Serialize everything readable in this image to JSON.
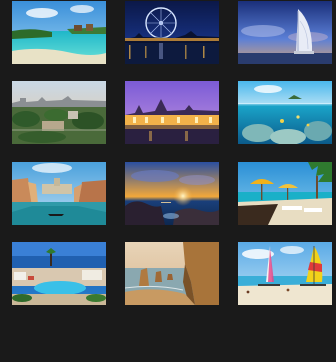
{
  "gallery": {
    "background": "#1a1a1a",
    "thumbnails": [
      {
        "subject": "tropical-lagoon"
      },
      {
        "subject": "ferris-wheel-night"
      },
      {
        "subject": "sail-hotel-dusk"
      },
      {
        "subject": "city-park-skyline"
      },
      {
        "subject": "palace-purple-sky"
      },
      {
        "subject": "underwater-reef"
      },
      {
        "subject": "venice-grand-canal"
      },
      {
        "subject": "rocky-coast-sunset"
      },
      {
        "subject": "beach-umbrellas"
      },
      {
        "subject": "resort-pool-coast"
      },
      {
        "subject": "sea-stacks-cliffs"
      },
      {
        "subject": "catamaran-beach"
      }
    ]
  }
}
